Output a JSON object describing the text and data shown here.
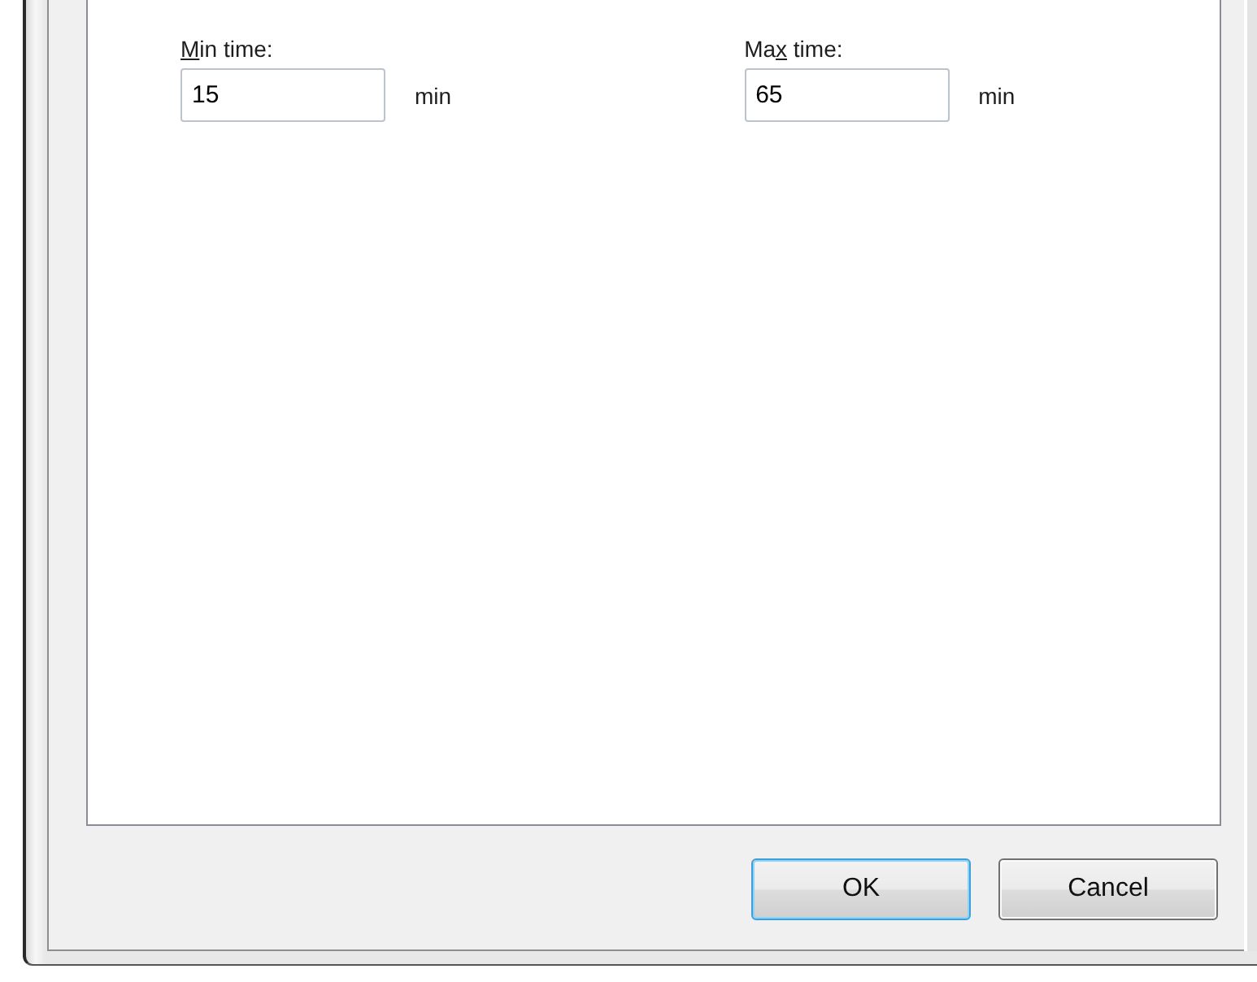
{
  "fields": [
    {
      "mnemonic": "M",
      "label_end": "in time:",
      "value": "15",
      "unit": "min"
    },
    {
      "label_start": "Ma",
      "mnemonic": "x",
      "label_end": " time:",
      "value": "65",
      "unit": "min"
    }
  ],
  "buttons": [
    {
      "label": "OK",
      "default": true
    },
    {
      "label": "Cancel",
      "default": false
    }
  ]
}
